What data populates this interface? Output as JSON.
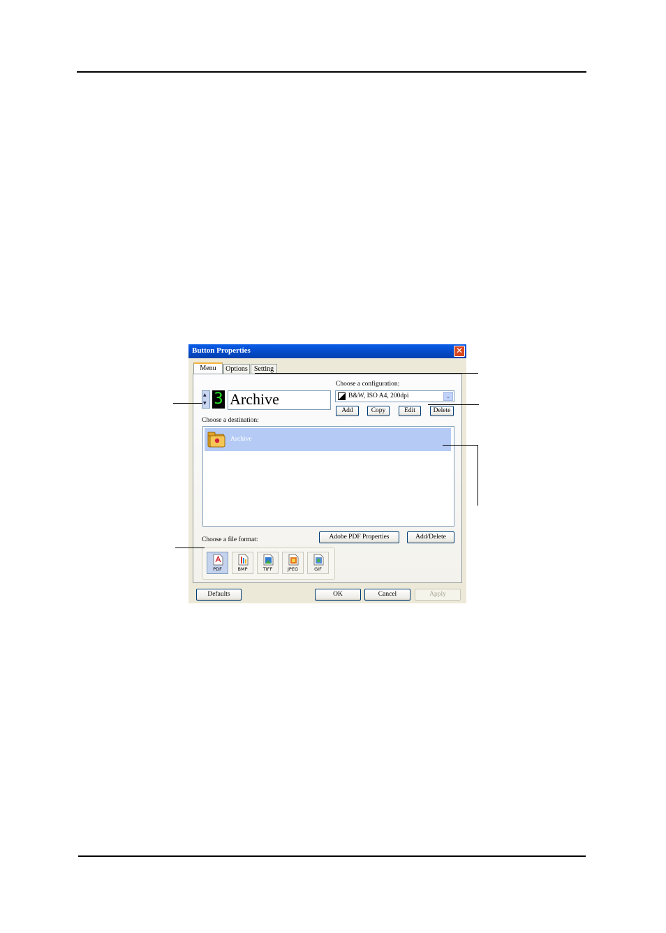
{
  "dialog": {
    "title": "Button Properties",
    "close_glyph": "✕",
    "tabs": [
      {
        "label": "Menu"
      },
      {
        "label": "Options"
      },
      {
        "label": "Setting"
      }
    ],
    "button_number": "3",
    "spin_up": "▲",
    "spin_down": "▼",
    "button_name": "Archive",
    "configuration": {
      "label": "Choose a configuration:",
      "value": "B&W, ISO A4, 200dpi",
      "arrow": "⌄",
      "buttons": {
        "add": "Add",
        "copy": "Copy",
        "edit": "Edit",
        "delete": "Delete"
      }
    },
    "destination": {
      "label": "Choose a destination:",
      "items": [
        {
          "label": "Archive",
          "icon": "folder-icon",
          "selected": true
        }
      ]
    },
    "file_format": {
      "label": "Choose a file format:",
      "formats": [
        {
          "label": "PDF",
          "icon": "pdf-icon",
          "selected": true
        },
        {
          "label": "BMP",
          "icon": "bmp-icon",
          "selected": false
        },
        {
          "label": "TIFF",
          "icon": "tiff-icon",
          "selected": false
        },
        {
          "label": "JPEG",
          "icon": "jpeg-icon",
          "selected": false
        },
        {
          "label": "GIF",
          "icon": "gif-icon",
          "selected": false
        }
      ],
      "adobe_pdf_properties": "Adobe PDF Properties",
      "add_delete": "Add/Delete"
    },
    "footer": {
      "defaults": "Defaults",
      "ok": "OK",
      "cancel": "Cancel",
      "apply": "Apply"
    }
  },
  "colors": {
    "title_bar": "#0A5EE8",
    "selection": "#B5CBF5",
    "digit": "#26E026",
    "close": "#D9461E",
    "dialog_bg": "#ECE9D8"
  }
}
